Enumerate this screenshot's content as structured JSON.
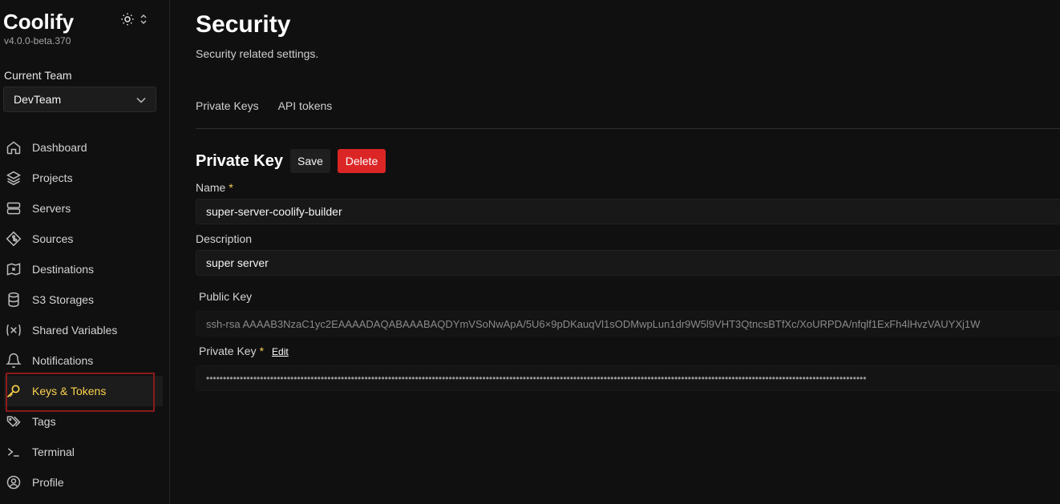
{
  "app": {
    "name": "Coolify",
    "version": "v4.0.0-beta.370"
  },
  "team": {
    "label": "Current Team",
    "selected": "DevTeam"
  },
  "sidebar": {
    "items": [
      {
        "label": "Dashboard",
        "icon": "home-icon"
      },
      {
        "label": "Projects",
        "icon": "layers-icon"
      },
      {
        "label": "Servers",
        "icon": "server-icon"
      },
      {
        "label": "Sources",
        "icon": "git-icon"
      },
      {
        "label": "Destinations",
        "icon": "destination-icon"
      },
      {
        "label": "S3 Storages",
        "icon": "database-icon"
      },
      {
        "label": "Shared Variables",
        "icon": "variable-icon"
      },
      {
        "label": "Notifications",
        "icon": "bell-icon"
      },
      {
        "label": "Keys & Tokens",
        "icon": "key-icon",
        "active": true
      },
      {
        "label": "Tags",
        "icon": "tags-icon"
      },
      {
        "label": "Terminal",
        "icon": "terminal-icon"
      },
      {
        "label": "Profile",
        "icon": "profile-icon"
      }
    ]
  },
  "page": {
    "title": "Security",
    "subtitle": "Security related settings.",
    "tabs": [
      "Private Keys",
      "API tokens"
    ]
  },
  "private_key": {
    "title": "Private Key",
    "save_label": "Save",
    "delete_label": "Delete",
    "name_label": "Name",
    "name_value": "super-server-coolify-builder",
    "description_label": "Description",
    "description_value": "super server",
    "public_key_label": "Public Key",
    "public_key_value": "ssh-rsa AAAAB3NzaC1yc2EAAAADAQABAAABAQDYmVSoNwApA/5U6×9pDKauqVl1sODMwpLun1dr9W5l9VHT3QtncsBTfXc/XoURPDA/nfqlf1ExFh4lHvzVAUYXj1W",
    "private_key_label": "Private Key",
    "edit_label": "Edit",
    "required_mark": "*"
  },
  "colors": {
    "accent": "#fcd34d",
    "danger": "#dc2626",
    "highlight": "#8b1a1a"
  }
}
